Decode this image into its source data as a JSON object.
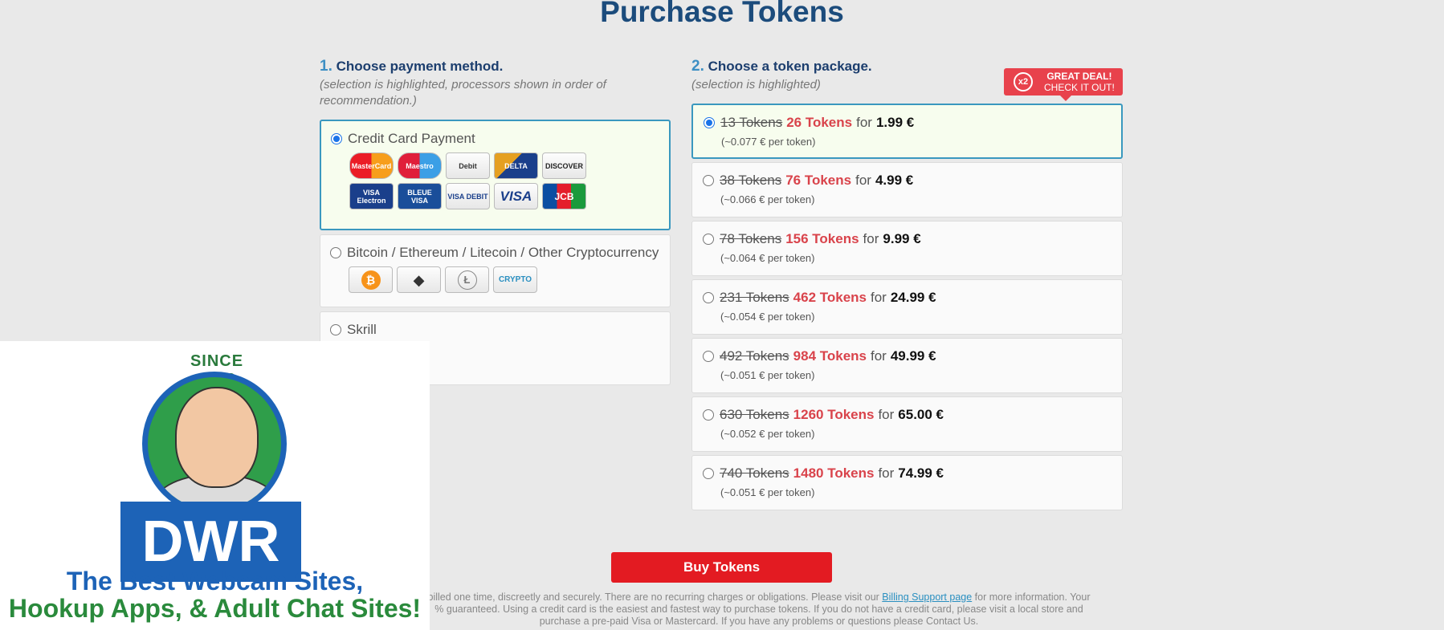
{
  "page": {
    "title": "Purchase Tokens"
  },
  "payment": {
    "step_num": "1.",
    "heading": "Choose payment method.",
    "subtitle": "(selection is highlighted, processors shown in order of recommendation.)",
    "methods": [
      {
        "label": "Credit Card Payment",
        "selected": true,
        "cards": [
          {
            "icon": "mastercard-icon",
            "text": "MasterCard"
          },
          {
            "icon": "maestro-icon",
            "text": "Maestro"
          },
          {
            "icon": "mastercard-debit-icon",
            "text": "Debit"
          },
          {
            "icon": "delta-icon",
            "text": "DELTA"
          },
          {
            "icon": "discover-icon",
            "text": "DISCOVER"
          },
          {
            "icon": "visa-electron-icon",
            "text": "VISA Electron"
          },
          {
            "icon": "carte-bleue-visa-icon",
            "text": "BLEUE VISA"
          },
          {
            "icon": "visa-debit-icon",
            "text": "VISA DEBIT"
          },
          {
            "icon": "visa-icon",
            "text": "VISA"
          },
          {
            "icon": "jcb-icon",
            "text": "JCB"
          }
        ]
      },
      {
        "label": "Bitcoin / Ethereum / Litecoin / Other Cryptocurrency",
        "selected": false,
        "cards": [
          {
            "icon": "bitcoin-icon",
            "text": "₿"
          },
          {
            "icon": "ethereum-icon",
            "text": "◆"
          },
          {
            "icon": "litecoin-icon",
            "text": "Ł"
          },
          {
            "icon": "crypto-icon",
            "text": "CRYPTO"
          }
        ]
      },
      {
        "label": "Skrill",
        "selected": false,
        "cards": []
      }
    ]
  },
  "packages": {
    "step_num": "2.",
    "heading": "Choose a token package.",
    "subtitle": "(selection is highlighted)",
    "deal_badge": {
      "x2": "x2",
      "line1": "GREAT DEAL!",
      "line2": "CHECK IT OUT!"
    },
    "items": [
      {
        "old": "13 Tokens",
        "new": "26 Tokens",
        "for": "for",
        "price": "1.99 €",
        "per": "(~0.077 € per token)",
        "selected": true
      },
      {
        "old": "38 Tokens",
        "new": "76 Tokens",
        "for": "for",
        "price": "4.99 €",
        "per": "(~0.066 € per token)",
        "selected": false
      },
      {
        "old": "78 Tokens",
        "new": "156 Tokens",
        "for": "for",
        "price": "9.99 €",
        "per": "(~0.064 € per token)",
        "selected": false
      },
      {
        "old": "231 Tokens",
        "new": "462 Tokens",
        "for": "for",
        "price": "24.99 €",
        "per": "(~0.054 € per token)",
        "selected": false
      },
      {
        "old": "492 Tokens",
        "new": "984 Tokens",
        "for": "for",
        "price": "49.99 €",
        "per": "(~0.051 € per token)",
        "selected": false
      },
      {
        "old": "630 Tokens",
        "new": "1260 Tokens",
        "for": "for",
        "price": "65.00 €",
        "per": "(~0.052 € per token)",
        "selected": false
      },
      {
        "old": "740 Tokens",
        "new": "1480 Tokens",
        "for": "for",
        "price": "74.99 €",
        "per": "(~0.051 € per token)",
        "selected": false
      }
    ]
  },
  "buy_button": "Buy Tokens",
  "legal": {
    "part1": "billed one time, discreetly and securely. There are no recurring charges or obligations. Please visit our ",
    "link": "Billing Support page",
    "part2": " for more information. Your",
    "line2": "% guaranteed. Using a credit card is the easiest and fastest way to purchase tokens. If you do not have a credit card, please visit a local store and",
    "line3": "purchase a pre-paid Visa or Mastercard. If you have any problems or questions please Contact Us."
  },
  "overlay": {
    "since": "SINCE 2010",
    "brand": "DWR",
    "tagline1": "The Best Webcam Sites,",
    "tagline2": "Hookup Apps, & Adult Chat Sites!"
  }
}
